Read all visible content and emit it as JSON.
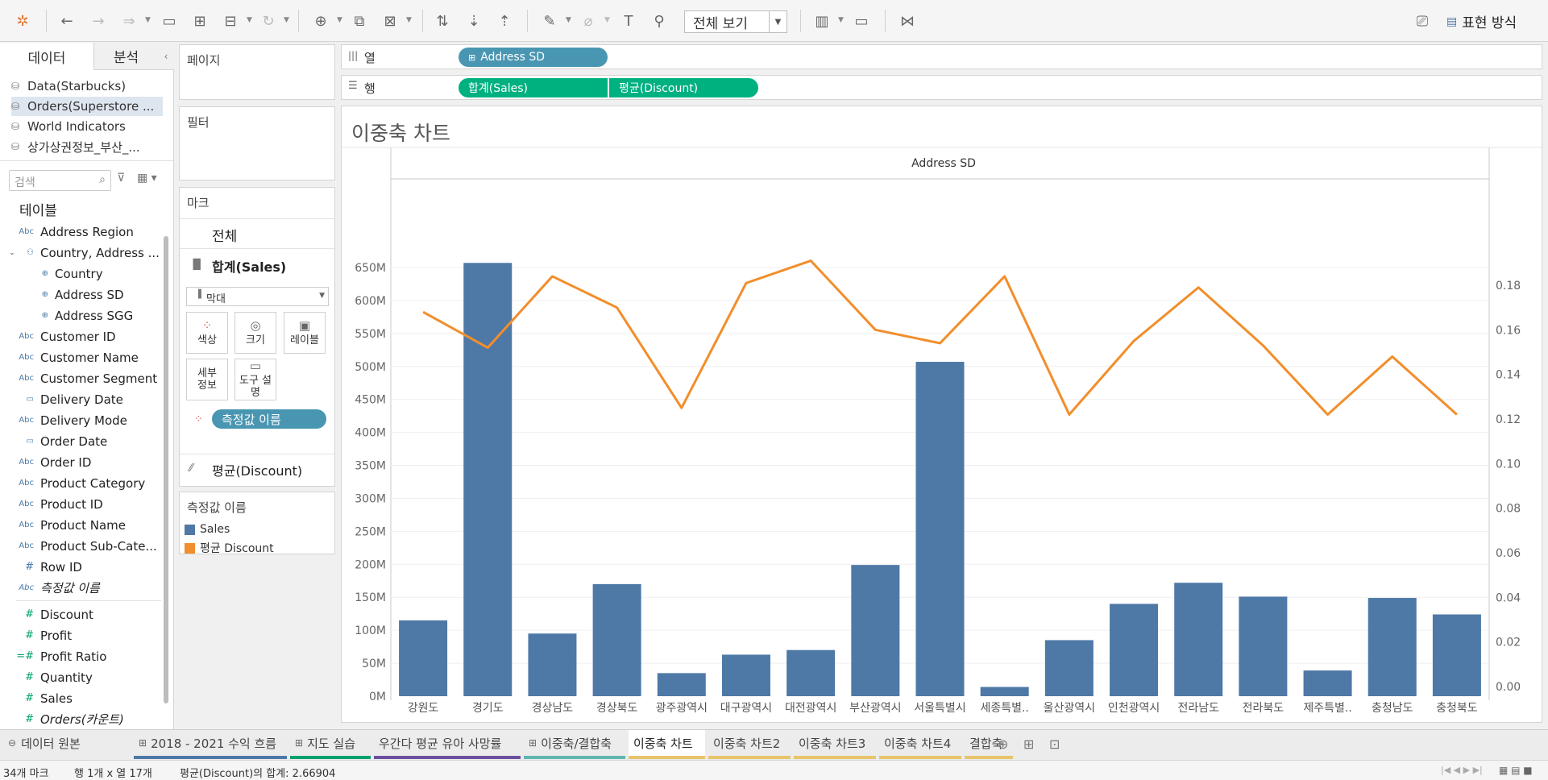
{
  "toolbar": {
    "fit_select": "전체 보기",
    "show_me": "표현 방식"
  },
  "data_pane": {
    "tab_data": "데이터",
    "tab_analysis": "분석",
    "datasources": [
      "Data(Starbucks)",
      "Orders(Superstore ...",
      "World Indicators",
      "상가상권정보_부산_..."
    ],
    "search_placeholder": "검색",
    "tables_header": "테이블",
    "dimensions": [
      {
        "type": "Abc",
        "label": "Address Region"
      },
      {
        "type": "hier",
        "label": "Country, Address ..."
      },
      {
        "type": "geo",
        "label": "Country",
        "sub": true
      },
      {
        "type": "geo",
        "label": "Address SD",
        "sub": true
      },
      {
        "type": "geo",
        "label": "Address SGG",
        "sub": true
      },
      {
        "type": "Abc",
        "label": "Customer ID"
      },
      {
        "type": "Abc",
        "label": "Customer Name"
      },
      {
        "type": "Abc",
        "label": "Customer Segment"
      },
      {
        "type": "date",
        "label": "Delivery Date"
      },
      {
        "type": "Abc",
        "label": "Delivery Mode"
      },
      {
        "type": "date",
        "label": "Order Date"
      },
      {
        "type": "Abc",
        "label": "Order ID"
      },
      {
        "type": "Abc",
        "label": "Product Category"
      },
      {
        "type": "Abc",
        "label": "Product ID"
      },
      {
        "type": "Abc",
        "label": "Product Name"
      },
      {
        "type": "Abc",
        "label": "Product Sub-Cate..."
      },
      {
        "type": "#",
        "label": "Row ID"
      },
      {
        "type": "Abc",
        "label": "측정값 이름",
        "italic": true
      }
    ],
    "measures": [
      {
        "type": "#",
        "label": "Discount"
      },
      {
        "type": "#",
        "label": "Profit"
      },
      {
        "type": "=#",
        "label": "Profit Ratio"
      },
      {
        "type": "#",
        "label": "Quantity"
      },
      {
        "type": "#",
        "label": "Sales"
      },
      {
        "type": "#",
        "label": "Orders(카운트)",
        "italic": true
      }
    ]
  },
  "cards": {
    "pages": "페이지",
    "filters": "필터",
    "marks": "마크",
    "marks_all": "전체",
    "marks_sales": "합계(Sales)",
    "mark_type": "막대",
    "btn_color": "색상",
    "btn_size": "크기",
    "btn_label": "레이블",
    "btn_detail": "세부\n정보",
    "btn_tooltip": "도구 설명",
    "measure_names_pill": "측정값 이름",
    "marks_discount": "평균(Discount)",
    "legend_title": "측정값 이름",
    "legend": [
      {
        "label": "Sales",
        "color": "#4e79a7"
      },
      {
        "label": "평균 Discount",
        "color": "#f28e2b"
      }
    ]
  },
  "shelves": {
    "columns_label": "열",
    "rows_label": "행",
    "columns_pill": "Address SD",
    "rows_pill_1": "합계(Sales)",
    "rows_pill_2": "평균(Discount)"
  },
  "viz": {
    "title": "이중축 차트"
  },
  "chart_data": {
    "type": "bar",
    "header": "Address SD",
    "categories": [
      "강원도",
      "경기도",
      "경상남도",
      "경상북도",
      "광주광역시",
      "대구광역시",
      "대전광역시",
      "부산광역시",
      "서울특별시",
      "세종특별..",
      "울산광역시",
      "인천광역시",
      "전라남도",
      "전라북도",
      "제주특별..",
      "충청남도",
      "충청북도"
    ],
    "series": [
      {
        "name": "Sales",
        "type": "bar",
        "axis": "left",
        "color": "#4e79a7",
        "values": [
          115,
          657,
          95,
          170,
          35,
          63,
          70,
          199,
          507,
          14,
          85,
          140,
          172,
          151,
          39,
          149,
          124
        ]
      },
      {
        "name": "평균 Discount",
        "type": "line",
        "axis": "right",
        "color": "#f28e2b",
        "values": [
          0.168,
          0.152,
          0.184,
          0.17,
          0.125,
          0.181,
          0.191,
          0.16,
          0.154,
          0.184,
          0.122,
          0.155,
          0.179,
          0.153,
          0.122,
          0.148,
          0.122
        ]
      }
    ],
    "y_left": {
      "ticks": [
        "0M",
        "50M",
        "100M",
        "150M",
        "200M",
        "250M",
        "300M",
        "350M",
        "400M",
        "450M",
        "500M",
        "550M",
        "600M",
        "650M"
      ],
      "min": 0,
      "max": 650
    },
    "y_right": {
      "ticks": [
        "0.00",
        "0.02",
        "0.04",
        "0.06",
        "0.08",
        "0.10",
        "0.12",
        "0.14",
        "0.16",
        "0.18"
      ],
      "min": 0,
      "max": 0.18
    }
  },
  "tabs": {
    "datasource": "데이터 원본",
    "sheets": [
      {
        "label": "2018 - 2021 수익 흐름",
        "color": "#4e79a7"
      },
      {
        "label": "지도 실습",
        "color": "#00a26d"
      },
      {
        "label": "우간다 평균 유아 사망률",
        "color": "#6d4fa0"
      },
      {
        "label": "이중축/결합축",
        "color": "#60b6b0"
      },
      {
        "label": "이중축 차트",
        "color": "#e8c46a",
        "active": true
      },
      {
        "label": "이중축 차트2",
        "color": "#e8c46a"
      },
      {
        "label": "이중축 차트3",
        "color": "#e8c46a"
      },
      {
        "label": "이중축 차트4",
        "color": "#e8c46a"
      },
      {
        "label": "결합축",
        "color": "#e8c46a"
      }
    ]
  },
  "status": {
    "marks": "34개 마크",
    "rows_cols": "행 1개 x 열 17개",
    "sum": "평균(Discount)의 합계: 2.66904"
  }
}
